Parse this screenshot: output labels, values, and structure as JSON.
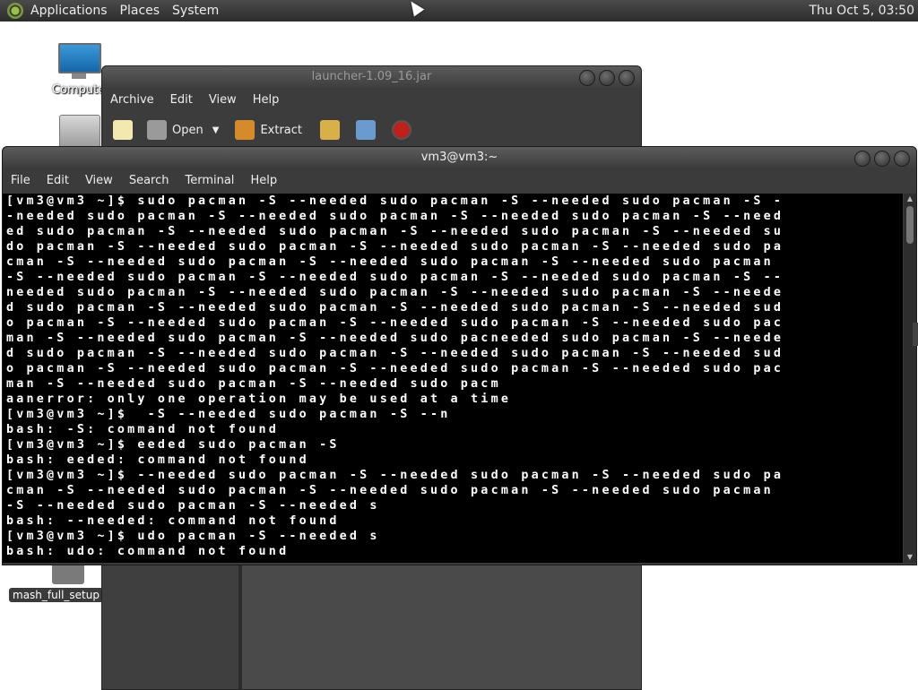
{
  "top_panel": {
    "menus": [
      "Applications",
      "Places",
      "System"
    ],
    "clock": "Thu Oct  5, 03:50"
  },
  "desktop": {
    "computer_label": "Computer",
    "mash_label": "mash_full_setup"
  },
  "archive_window": {
    "title": "launcher-1.09_16.jar",
    "menus": [
      "Archive",
      "Edit",
      "View",
      "Help"
    ],
    "toolbar": {
      "open_label": "Open",
      "extract_label": "Extract"
    }
  },
  "terminal_window": {
    "title": "vm3@vm3:~",
    "menus": [
      "File",
      "Edit",
      "View",
      "Search",
      "Terminal",
      "Help"
    ],
    "lines": [
      "[vm3@vm3 ~]$ sudo pacman -S --needed sudo pacman -S --needed sudo pacman -S -",
      "-needed sudo pacman -S --needed sudo pacman -S --needed sudo pacman -S --need",
      "ed sudo pacman -S --needed sudo pacman -S --needed sudo pacman -S --needed su",
      "do pacman -S --needed sudo pacman -S --needed sudo pacman -S --needed sudo pa",
      "cman -S --needed sudo pacman -S --needed sudo pacman -S --needed sudo pacman",
      "-S --needed sudo pacman -S --needed sudo pacman -S --needed sudo pacman -S --",
      "needed sudo pacman -S --needed sudo pacman -S --needed sudo pacman -S --neede",
      "d sudo pacman -S --needed sudo pacman -S --needed sudo pacman -S --needed sud",
      "o pacman -S --needed sudo pacman -S --needed sudo pacman -S --needed sudo pac",
      "man -S --needed sudo pacman -S --needed sudo pacneeded sudo pacman -S --neede",
      "d sudo pacman -S --needed sudo pacman -S --needed sudo pacman -S --needed sud",
      "o pacman -S --needed sudo pacman -S --needed sudo pacman -S --needed sudo pac",
      "man -S --needed sudo pacman -S --needed sudo pacm",
      "aanerror: only one operation may be used at a time",
      "[vm3@vm3 ~]$  -S --needed sudo pacman -S --n",
      "bash: -S: command not found",
      "[vm3@vm3 ~]$ eeded sudo pacman -S",
      "bash: eeded: command not found",
      "[vm3@vm3 ~]$ --needed sudo pacman -S --needed sudo pacman -S --needed sudo pa",
      "cman -S --needed sudo pacman -S --needed sudo pacman -S --needed sudo pacman",
      "-S --needed sudo pacman -S --needed s",
      "bash: --needed: command not found",
      "[vm3@vm3 ~]$ udo pacman -S --needed s",
      "bash: udo: command not found"
    ]
  }
}
